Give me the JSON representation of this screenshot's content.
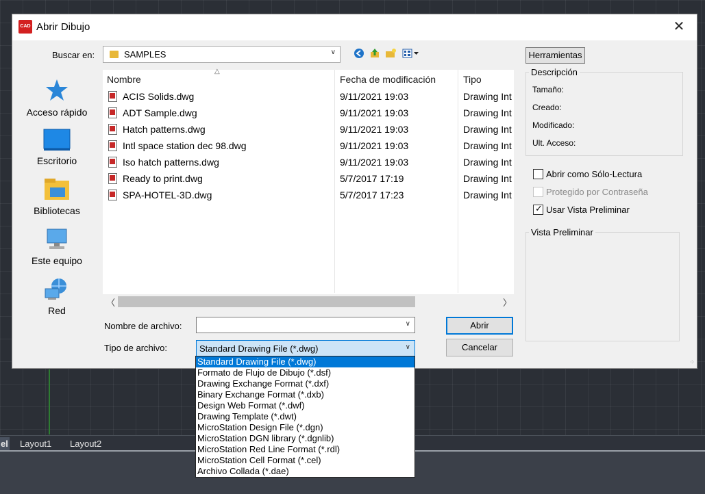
{
  "dialog": {
    "app_icon": "autocad-logo-icon",
    "title": "Abrir Dibujo",
    "close_label": "✕"
  },
  "lookin": {
    "label": "Buscar en:",
    "value": "SAMPLES"
  },
  "toolbar": {
    "back_icon": "back-arrow-icon",
    "up_icon": "up-folder-icon",
    "new_folder_icon": "new-folder-icon",
    "views_icon": "view-menu-icon",
    "tools_label": "Herramientas"
  },
  "places": [
    {
      "label": "Acceso rápido",
      "icon": "star-icon"
    },
    {
      "label": "Escritorio",
      "icon": "desktop-icon"
    },
    {
      "label": "Bibliotecas",
      "icon": "libraries-icon"
    },
    {
      "label": "Este equipo",
      "icon": "computer-icon"
    },
    {
      "label": "Red",
      "icon": "network-icon"
    }
  ],
  "filelist": {
    "columns": [
      "Nombre",
      "Fecha de modificación",
      "Tipo"
    ],
    "rows": [
      {
        "name": "ACIS Solids.dwg",
        "date": "9/11/2021 19:03",
        "type": "Drawing Int"
      },
      {
        "name": "ADT Sample.dwg",
        "date": "9/11/2021 19:03",
        "type": "Drawing Int"
      },
      {
        "name": "Hatch patterns.dwg",
        "date": "9/11/2021 19:03",
        "type": "Drawing Int"
      },
      {
        "name": "Intl space station dec 98.dwg",
        "date": "9/11/2021 19:03",
        "type": "Drawing Int"
      },
      {
        "name": "Iso hatch patterns.dwg",
        "date": "9/11/2021 19:03",
        "type": "Drawing Int"
      },
      {
        "name": "Ready to print.dwg",
        "date": "5/7/2017 17:19",
        "type": "Drawing Int"
      },
      {
        "name": "SPA-HOTEL-3D.dwg",
        "date": "5/7/2017 17:23",
        "type": "Drawing Int"
      }
    ]
  },
  "filename": {
    "label": "Nombre de archivo:",
    "value": ""
  },
  "filetype": {
    "label": "Tipo de archivo:",
    "value": "Standard Drawing File (*.dwg)",
    "options": [
      "Standard Drawing File (*.dwg)",
      "Formato de Flujo de Dibujo  (*.dsf)",
      "Drawing Exchange Format (*.dxf)",
      "Binary Exchange Format (*.dxb)",
      "Design Web Format (*.dwf)",
      "Drawing Template (*.dwt)",
      "MicroStation Design File (*.dgn)",
      "MicroStation DGN library (*.dgnlib)",
      "MicroStation Red Line Format (*.rdl)",
      "MicroStation Cell Format (*.cel)",
      "Archivo Collada (*.dae)"
    ]
  },
  "buttons": {
    "open": "Abrir",
    "cancel": "Cancelar"
  },
  "description": {
    "title": "Descripción",
    "size_label": "Tamaño:",
    "created_label": "Creado:",
    "modified_label": "Modificado:",
    "accessed_label": "Ult. Acceso:"
  },
  "options": {
    "readonly_label": "Abrir como Sólo-Lectura",
    "password_label": "Protegido por Contraseña",
    "preview_label": "Usar Vista Preliminar"
  },
  "preview": {
    "title": "Vista Preliminar"
  },
  "layout_tabs": [
    "el",
    "Layout1",
    "Layout2"
  ],
  "colors": {
    "accent": "#0078d7",
    "cad_background": "#2b2f36"
  }
}
